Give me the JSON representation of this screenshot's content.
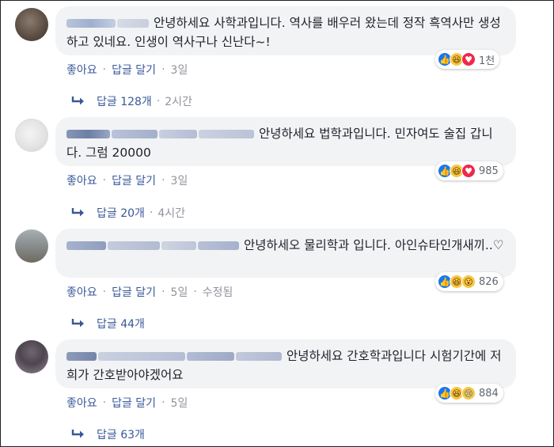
{
  "comments": [
    {
      "text": "안녕하세요 사학과입니다. 역사를 배우러 왔는데 정작 흑역사만 생성하고 있네요. 인생이 역사구나 신난다~!",
      "reaction_count": "1천",
      "reactions": [
        "like",
        "haha",
        "love"
      ],
      "like_label": "좋아요",
      "reply_label": "답글 달기",
      "time": "3일",
      "replies_label": "답글 128개",
      "replies_time": "2시간",
      "edited": ""
    },
    {
      "text": "안녕하세요 법학과입니다. 민자여도 술집 갑니다. 그럼 20000",
      "reaction_count": "985",
      "reactions": [
        "like",
        "haha",
        "love"
      ],
      "like_label": "좋아요",
      "reply_label": "답글 달기",
      "time": "3일",
      "replies_label": "답글 20개",
      "replies_time": "4시간",
      "edited": ""
    },
    {
      "text": "안녕하세오 물리학과 입니다. 아인슈타인개새끼..♡",
      "reaction_count": "826",
      "reactions": [
        "like",
        "haha",
        "wow"
      ],
      "like_label": "좋아요",
      "reply_label": "답글 달기",
      "time": "5일",
      "replies_label": "답글 44개",
      "replies_time": "",
      "edited": "수정됨"
    },
    {
      "text": "안녕하세요 간호학과입니다 시험기간에 저희가 간호받아야겠어요",
      "reaction_count": "884",
      "reactions": [
        "like",
        "haha",
        "sad"
      ],
      "like_label": "좋아요",
      "reply_label": "답글 달기",
      "time": "5일",
      "replies_label": "답글 63개",
      "replies_time": "",
      "edited": ""
    }
  ],
  "icons": {
    "like": "👍",
    "haha": "😆",
    "love": "♥",
    "wow": "😮",
    "sad": "😢"
  },
  "colors": {
    "link": "#385898",
    "meta": "#90949c",
    "bubble": "#f2f3f5",
    "like": "#1877f2",
    "love": "#f0284a",
    "emoji": "#f7c742"
  }
}
